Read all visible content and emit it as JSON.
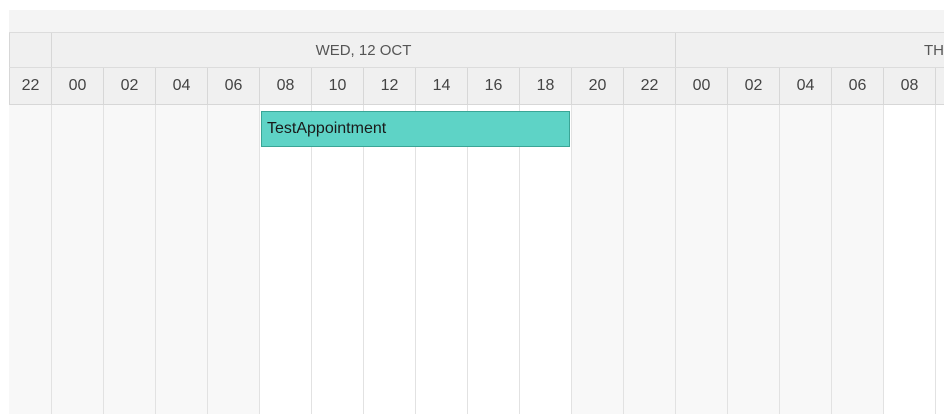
{
  "scheduler": {
    "dates": [
      {
        "label": "WED, 12 OCT"
      },
      {
        "label": "TH"
      }
    ],
    "hours": [
      "22",
      "00",
      "02",
      "04",
      "06",
      "08",
      "10",
      "12",
      "14",
      "16",
      "18",
      "20",
      "22",
      "00",
      "02",
      "04",
      "06",
      "08"
    ],
    "appointment": {
      "title": "TestAppointment",
      "color": "#5ed3c6"
    }
  }
}
